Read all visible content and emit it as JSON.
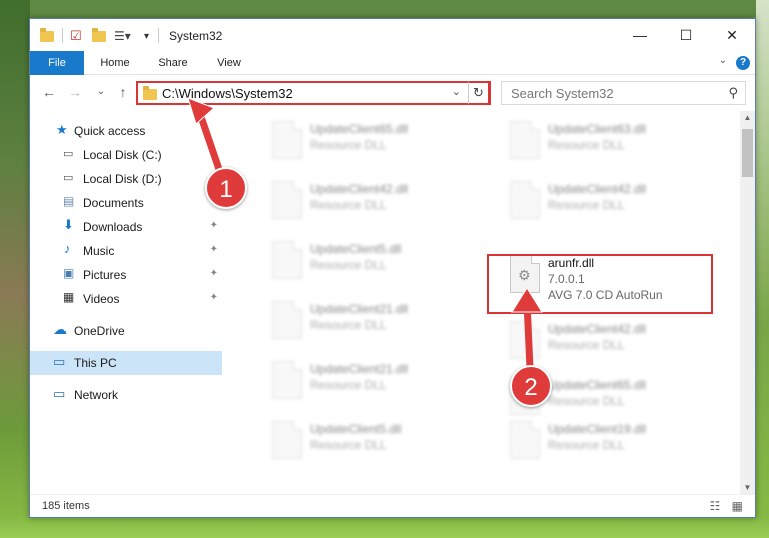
{
  "window": {
    "title": "System32",
    "minimize_glyph": "—",
    "maximize_glyph": "☐",
    "close_glyph": "✕"
  },
  "ribbon": {
    "tabs": [
      {
        "label": "File"
      },
      {
        "label": "Home"
      },
      {
        "label": "Share"
      },
      {
        "label": "View"
      }
    ],
    "help_label": "?"
  },
  "nav": {
    "back": "←",
    "forward": "→",
    "recent": "⌄",
    "up": "↑"
  },
  "address": {
    "path": "C:\\Windows\\System32",
    "dropdown": "⌄",
    "refresh": "↻"
  },
  "search": {
    "placeholder": "Search System32",
    "icon": "⚲"
  },
  "sidebar": {
    "items": [
      {
        "label": "Quick access",
        "icon": "star-icon",
        "pinned": false
      },
      {
        "label": "Local Disk (C:)",
        "icon": "drive-icon",
        "pinned": false
      },
      {
        "label": "Local Disk (D:)",
        "icon": "drive-icon",
        "pinned": false
      },
      {
        "label": "Documents",
        "icon": "documents-icon",
        "pinned": true
      },
      {
        "label": "Downloads",
        "icon": "download-icon",
        "pinned": true
      },
      {
        "label": "Music",
        "icon": "music-icon",
        "pinned": true
      },
      {
        "label": "Pictures",
        "icon": "pictures-icon",
        "pinned": true
      },
      {
        "label": "Videos",
        "icon": "videos-icon",
        "pinned": true
      },
      {
        "label": "OneDrive",
        "icon": "cloud-icon",
        "pinned": false
      },
      {
        "label": "This PC",
        "icon": "computer-icon",
        "pinned": false,
        "selected": true
      },
      {
        "label": "Network",
        "icon": "network-icon",
        "pinned": false
      }
    ],
    "pin_glyph": "📌"
  },
  "files": [
    {
      "name": "UpdateClient65.dll",
      "desc": "Resource DLL"
    },
    {
      "name": "UpdateClient63.dll",
      "desc": "Resource DLL"
    },
    {
      "name": "UpdateClient42.dll",
      "desc": "Resource DLL"
    },
    {
      "name": "UpdateClient42.dll",
      "desc": "Resource DLL"
    },
    {
      "name": "UpdateClient5.dll",
      "desc": "Resource DLL"
    },
    {
      "name": "arunfr.dll",
      "version": "7.0.0.1",
      "desc": "AVG 7.0 CD AutoRun",
      "highlighted": true
    },
    {
      "name": "UpdateClient21.dll",
      "desc": "Resource DLL"
    },
    {
      "name": "UpdateClient42.dll",
      "desc": "Resource DLL"
    },
    {
      "name": "UpdateClient21.dll",
      "desc": "Resource DLL"
    },
    {
      "name": "UpdateClient65.dll",
      "desc": "Resource DLL"
    },
    {
      "name": "UpdateClient5.dll",
      "desc": "Resource DLL"
    },
    {
      "name": "UpdateClient19.dll",
      "desc": "Resource DLL"
    }
  ],
  "status": {
    "count": "185 items"
  },
  "annotations": {
    "step1": "1",
    "step2": "2"
  },
  "colors": {
    "accent": "#1979ca",
    "highlight_red": "#d93535",
    "selected_bg": "#cce4f7"
  }
}
